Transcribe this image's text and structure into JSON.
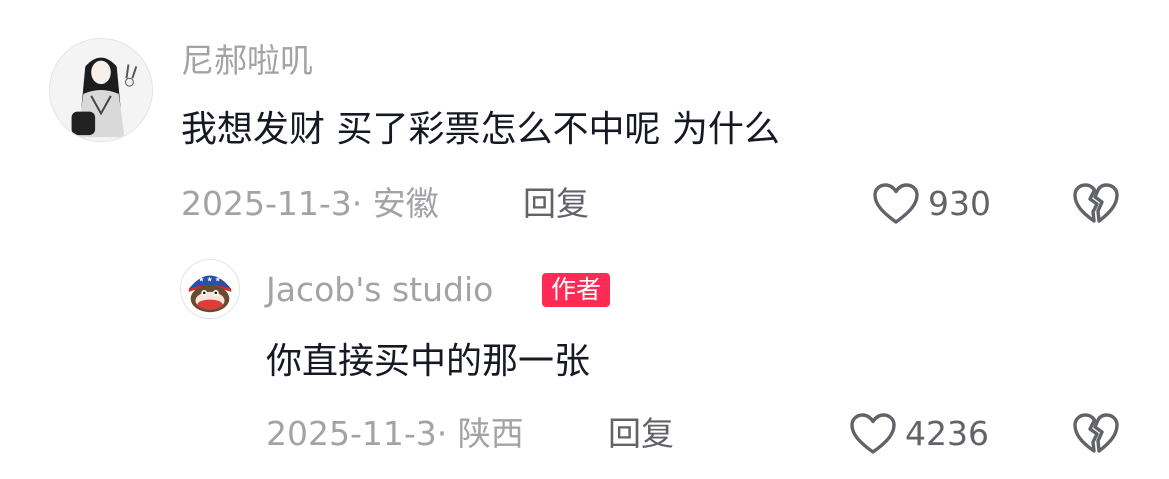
{
  "comment": {
    "username": "尼郝啦叽",
    "text": "我想发财  买了彩票怎么不中呢  为什么",
    "date_location": "2025-11-3· 安徽",
    "reply_label": "回复",
    "likes": "930"
  },
  "reply": {
    "username": "Jacob's studio",
    "author_badge": "作者",
    "text": "你直接买中的那一张",
    "date_location": "2025-11-3· 陕西",
    "reply_label": "回复",
    "likes": "4236"
  },
  "colors": {
    "primary_text": "#161823",
    "secondary_text": "#a3a3a6",
    "action_text": "#626369",
    "author_badge_bg": "#fe2c55"
  },
  "icons": {
    "like": "heart-outline-icon",
    "dislike": "broken-heart-icon"
  }
}
